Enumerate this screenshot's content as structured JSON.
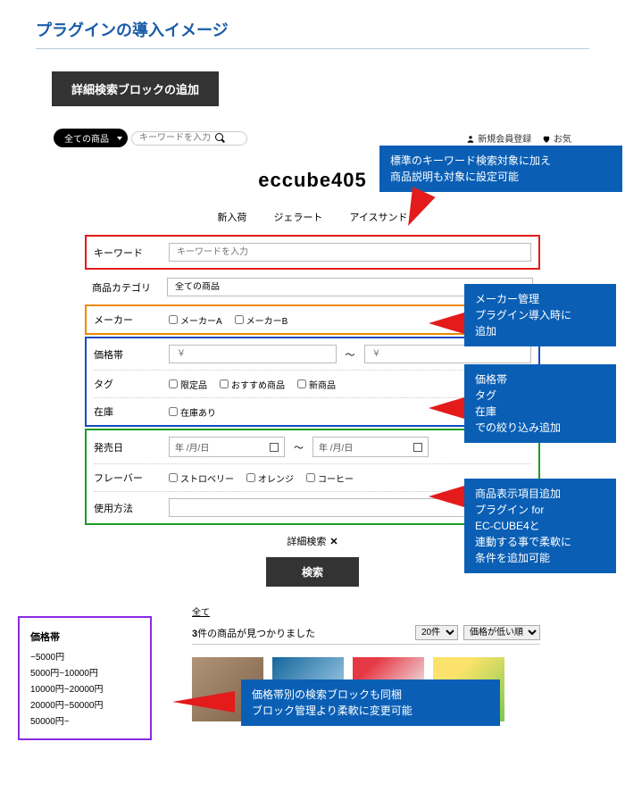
{
  "page_title": "プラグインの導入イメージ",
  "section_header": "詳細検索ブロックの追加",
  "topbar": {
    "category_label": "全ての商品",
    "search_placeholder": "キーワードを入力",
    "signup_label": "新規会員登録",
    "fav_label": "お気"
  },
  "site_title": "eccube405",
  "nav_tabs": [
    "新入荷",
    "ジェラート",
    "アイスサンド"
  ],
  "form": {
    "keyword_label": "キーワード",
    "keyword_placeholder": "キーワードを入力",
    "category_label": "商品カテゴリ",
    "category_value": "全ての商品",
    "maker_label": "メーカー",
    "maker_options": [
      "メーカーA",
      "メーカーB"
    ],
    "price_label": "価格帯",
    "price_placeholder": "￥",
    "tag_label": "タグ",
    "tag_options": [
      "限定品",
      "おすすめ商品",
      "新商品"
    ],
    "stock_label": "在庫",
    "stock_options": [
      "在庫あり"
    ],
    "release_label": "発売日",
    "date_placeholder": "年 /月/日",
    "flavor_label": "フレーバー",
    "flavor_options": [
      "ストロベリー",
      "オレンジ",
      "コーヒー"
    ],
    "usage_label": "使用方法",
    "detail_toggle": "詳細検索",
    "search_btn": "検索"
  },
  "callouts": {
    "c1": "標準のキーワード検索対象に加え\n商品説明も対象に設定可能",
    "c2": "メーカー管理\nプラグイン導入時に\n追加",
    "c3": "価格帯\nタグ\n在庫\nでの絞り込み追加",
    "c4": "商品表示項目追加\nプラグイン for\nEC-CUBE4と\n連動する事で柔軟に\n条件を追加可能",
    "c5": "価格帯別の検索ブロックも同梱\nブロック管理より柔軟に変更可能"
  },
  "price_block": {
    "title": "価格帯",
    "ranges": [
      "~5000円",
      "5000円~10000円",
      "10000円~20000円",
      "20000円~50000円",
      "50000円~"
    ]
  },
  "results": {
    "all_label": "全て",
    "count_text": "3件の商品が見つかりました",
    "per_page": "20件",
    "sort": "価格が低い順"
  }
}
